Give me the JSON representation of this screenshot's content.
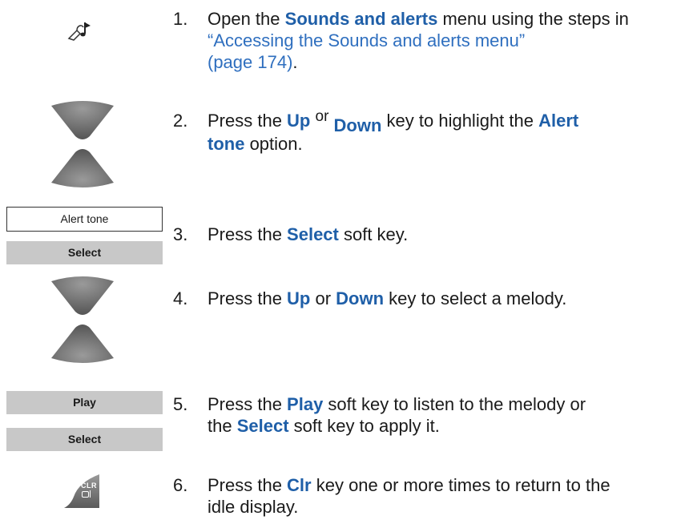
{
  "steps": [
    {
      "num": "1.",
      "pre": "Open the ",
      "key": "Sounds and alerts",
      "mid": " menu using the steps in ",
      "link1": "“Accessing the Sounds and alerts menu”",
      "link2": "(page 174)",
      "post": "."
    },
    {
      "num": "2.",
      "pre": "Press the ",
      "key1": "Up",
      "or": "or",
      "key2": "Down",
      "mid": " key to highlight the ",
      "key3": "Alert",
      "key4": "tone",
      "post": " option."
    },
    {
      "num": "3.",
      "pre": "Press the ",
      "key": "Select",
      "post": " soft key."
    },
    {
      "num": "4.",
      "pre": "Press the ",
      "key1": "Up",
      "or": " or ",
      "key2": "Down",
      "post": " key to select a melody."
    },
    {
      "num": "5.",
      "pre": "Press the ",
      "key1": "Play",
      "mid": " soft key to listen to the melody or",
      "pre2": "the ",
      "key2": "Select",
      "post": " soft key to apply it."
    },
    {
      "num": "6.",
      "pre": "Press the ",
      "key": "Clr",
      "post": " key one or more times to return to the",
      "line2": "idle display."
    }
  ],
  "display": {
    "alert_tone": "Alert tone"
  },
  "softkeys": {
    "select_1": "Select",
    "play": "Play",
    "select_2": "Select"
  },
  "clr_key": {
    "line1": "CLR"
  },
  "icons": [
    "sounds-menu-icon",
    "up-arrow-key-icon",
    "down-arrow-key-icon",
    "clr-key-icon"
  ]
}
